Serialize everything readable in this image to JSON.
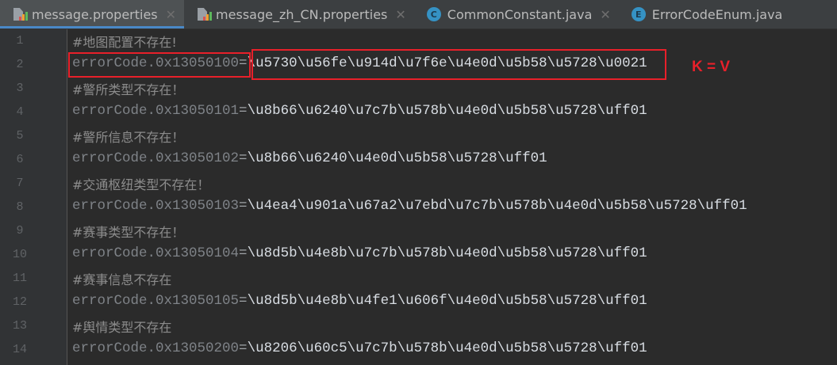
{
  "tabs": [
    {
      "label": "message.properties",
      "icon": "properties-file-icon",
      "active": true,
      "closable": true
    },
    {
      "label": "message_zh_CN.properties",
      "icon": "properties-file-icon",
      "active": false,
      "closable": true
    },
    {
      "label": "CommonConstant.java",
      "icon": "class-icon",
      "icon_letter": "C",
      "active": false,
      "closable": true
    },
    {
      "label": "ErrorCodeEnum.java",
      "icon": "enum-icon",
      "icon_letter": "E",
      "active": false,
      "closable": false
    }
  ],
  "close_glyph": "✕",
  "lines": [
    {
      "n": "1",
      "comment": "#地图配置不存在!"
    },
    {
      "n": "2",
      "key": "errorCode.0x13050100",
      "eq": "=",
      "value": "\\u5730\\u56fe\\u914d\\u7f6e\\u4e0d\\u5b58\\u5728\\u0021"
    },
    {
      "n": "3",
      "comment": "#警所类型不存在！"
    },
    {
      "n": "4",
      "key": "errorCode.0x13050101",
      "eq": "=",
      "value": "\\u8b66\\u6240\\u7c7b\\u578b\\u4e0d\\u5b58\\u5728\\uff01"
    },
    {
      "n": "5",
      "comment": "#警所信息不存在！"
    },
    {
      "n": "6",
      "key": "errorCode.0x13050102",
      "eq": "=",
      "value": "\\u8b66\\u6240\\u4e0d\\u5b58\\u5728\\uff01"
    },
    {
      "n": "7",
      "comment": "#交通枢纽类型不存在！"
    },
    {
      "n": "8",
      "key": "errorCode.0x13050103",
      "eq": "=",
      "value": "\\u4ea4\\u901a\\u67a2\\u7ebd\\u7c7b\\u578b\\u4e0d\\u5b58\\u5728\\uff01"
    },
    {
      "n": "9",
      "comment": "#赛事类型不存在！"
    },
    {
      "n": "10",
      "key": "errorCode.0x13050104",
      "eq": "=",
      "value": "\\u8d5b\\u4e8b\\u7c7b\\u578b\\u4e0d\\u5b58\\u5728\\uff01"
    },
    {
      "n": "11",
      "comment": "#赛事信息不存在"
    },
    {
      "n": "12",
      "key": "errorCode.0x13050105",
      "eq": "=",
      "value": "\\u8d5b\\u4e8b\\u4fe1\\u606f\\u4e0d\\u5b58\\u5728\\uff01"
    },
    {
      "n": "13",
      "comment": "#舆情类型不存在"
    },
    {
      "n": "14",
      "key": "errorCode.0x13050200",
      "eq": "=",
      "value": "\\u8206\\u60c5\\u7c7b\\u578b\\u4e0d\\u5b58\\u5728\\uff01"
    }
  ],
  "annotation": {
    "label": "K = V",
    "color": "#e8202a"
  }
}
